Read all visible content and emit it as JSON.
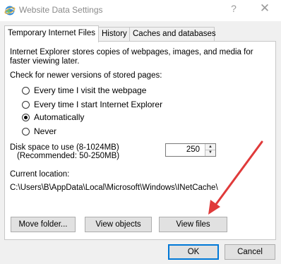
{
  "window": {
    "title": "Website Data Settings",
    "help_label": "?",
    "close_label": "✕",
    "icon": "internet-explorer-globe-icon"
  },
  "tabs": [
    {
      "label": "Temporary Internet Files",
      "active": true
    },
    {
      "label": "History",
      "active": false
    },
    {
      "label": "Caches and databases",
      "active": false
    }
  ],
  "panel": {
    "intro": "Internet Explorer stores copies of webpages, images, and media for faster viewing later.",
    "check_label": "Check for newer versions of stored pages:",
    "options": [
      {
        "label": "Every time I visit the webpage",
        "checked": false
      },
      {
        "label": "Every time I start Internet Explorer",
        "checked": false
      },
      {
        "label": "Automatically",
        "checked": true
      },
      {
        "label": "Never",
        "checked": false
      }
    ],
    "disk_label_1": "Disk space to use (8-1024MB)",
    "disk_label_2": "(Recommended: 50-250MB)",
    "disk_value": "250",
    "location_label": "Current location:",
    "location_path": "C:\\Users\\B\\AppData\\Local\\Microsoft\\Windows\\INetCache\\",
    "buttons": {
      "move_folder": "Move folder...",
      "view_objects": "View objects",
      "view_files": "View files"
    }
  },
  "footer": {
    "ok": "OK",
    "cancel": "Cancel"
  },
  "colors": {
    "annotation_arrow": "#e03a3a",
    "ok_focus": "#0078d7"
  }
}
